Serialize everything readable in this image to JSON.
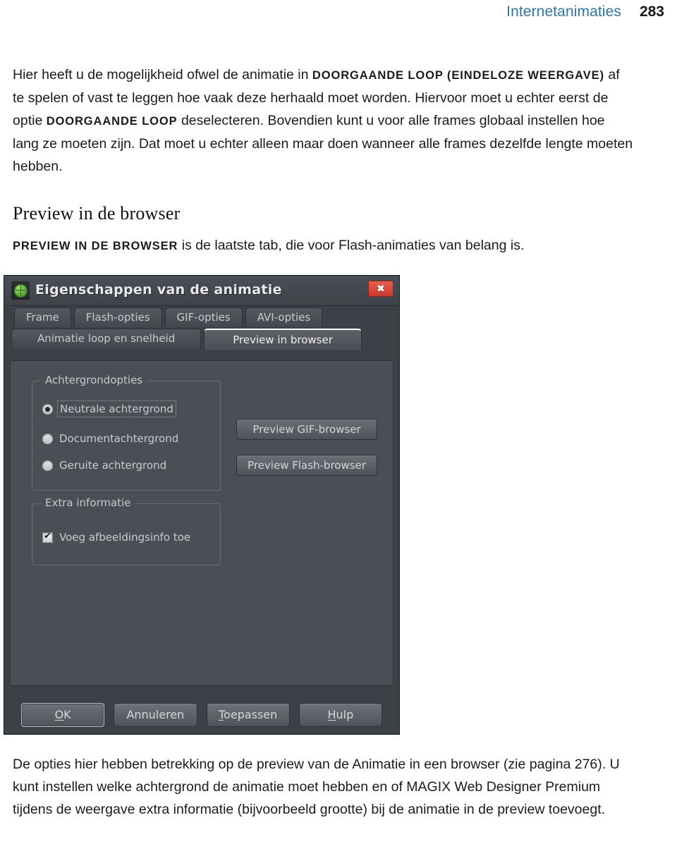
{
  "running_head": {
    "chapter": "Internetanimaties",
    "page_number": "283"
  },
  "body": {
    "paragraph1_part1": "Hier heeft u de mogelijkheid ofwel de animatie in ",
    "paragraph1_sc1": "DOORGAANDE LOOP (EINDELOZE WEERGAVE)",
    "paragraph1_part2": " af te spelen of vast te leggen hoe vaak deze herhaald moet worden. Hiervoor moet u echter eerst de optie ",
    "paragraph1_sc2": "DOORGAANDE LOOP",
    "paragraph1_part3": " deselecteren. Bovendien kunt u voor alle frames globaal instellen hoe lang ze moeten zijn. Dat moet u echter alleen maar doen wanneer alle frames dezelfde lengte moeten hebben.",
    "heading": "Preview in de browser",
    "paragraph2_sc": "PREVIEW IN DE BROWSER",
    "paragraph2_rest": " is de laatste tab, die voor Flash-animaties van belang is.",
    "paragraph3": "De opties hier hebben betrekking op de preview van de Animatie in een browser (zie pagina 276). U kunt instellen welke achtergrond de animatie moet hebben en of MAGIX Web Designer Premium tijdens de weergave extra informatie (bijvoorbeeld grootte) bij de animatie in de preview toevoegt."
  },
  "dialog": {
    "title": "Eigenschappen van de animatie",
    "title_icon": "globe-icon",
    "close_label": "✖",
    "tabs_row1": [
      {
        "label": "Frame",
        "active": false
      },
      {
        "label": "Flash-opties",
        "active": false
      },
      {
        "label": "GIF-opties",
        "active": false
      },
      {
        "label": "AVI-opties",
        "active": false
      }
    ],
    "tabs_row2": [
      {
        "label": "Animatie loop en snelheid",
        "active": false
      },
      {
        "label": "Preview in browser",
        "active": true
      }
    ],
    "groups": {
      "background": {
        "title": "Achtergrondopties",
        "options": [
          {
            "label": "Neutrale achtergrond",
            "selected": true,
            "focused": true
          },
          {
            "label": "Documentachtergrond",
            "selected": false,
            "focused": false
          },
          {
            "label": "Geruite achtergrond",
            "selected": false,
            "focused": false
          }
        ]
      },
      "extra": {
        "title": "Extra informatie",
        "checkbox_label": "Voeg afbeeldingsinfo toe",
        "checkbox_checked": true
      }
    },
    "preview_buttons": {
      "gif": "Preview GIF-browser",
      "flash": "Preview Flash-browser"
    },
    "footer_buttons": {
      "ok_accel": "O",
      "ok_rest": "K",
      "cancel": "Annuleren",
      "apply_accel": "T",
      "apply_rest": "oepassen",
      "help_accel": "H",
      "help_rest": "ulp"
    }
  },
  "colors": {
    "running_head_blue": "#2f76a2",
    "dialog_bg": "#3c4047",
    "panel_bg": "#4b4f55",
    "close_red": "#c8392c",
    "globe_green": "#4e9e33"
  }
}
